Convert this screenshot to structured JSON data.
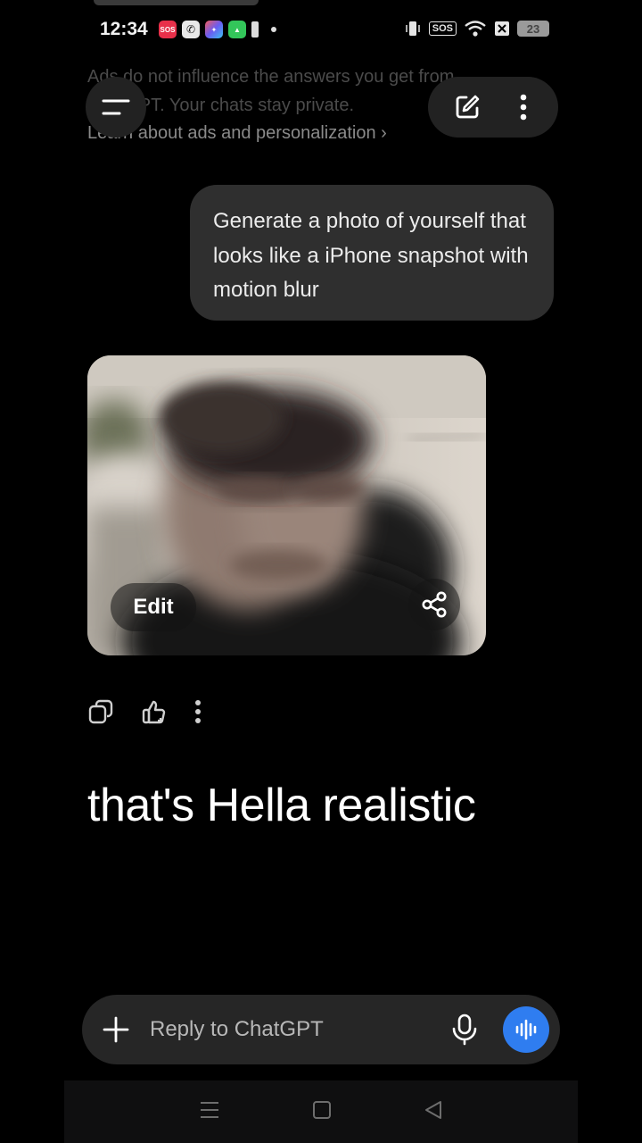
{
  "status_bar": {
    "time": "12:34",
    "sos_label": "SOS",
    "battery_level": "23"
  },
  "ad_notice": {
    "text": "Ads do not influence the answers you get from ChatGPT. Your chats stay private.",
    "link_label": "Learn about ads and personalization ›"
  },
  "header": {
    "menu_icon": "menu-icon",
    "new_chat_icon": "edit-icon",
    "more_icon": "more-vertical-icon"
  },
  "conversation": {
    "user_message": "Generate a photo of yourself that looks like a iPhone snapshot with motion blur",
    "image_edit_label": "Edit",
    "image_share_icon": "share-icon"
  },
  "message_actions": {
    "copy_icon": "copy-icon",
    "like_icon": "thumbs-up-icon",
    "more_icon": "more-vertical-icon"
  },
  "caption": "that's Hella realistic",
  "composer": {
    "placeholder": "Reply to ChatGPT",
    "voice_color": "#2f7df0"
  },
  "nav_bar": {
    "recents_icon": "menu-lines-icon",
    "home_icon": "square-icon",
    "back_icon": "triangle-back-icon"
  }
}
